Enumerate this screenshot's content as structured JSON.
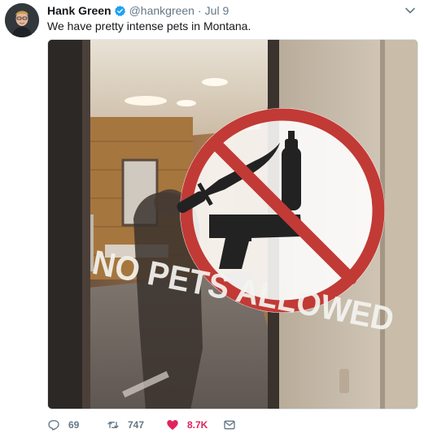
{
  "tweet": {
    "display_name": "Hank Green",
    "handle": "@hankgreen",
    "separator": "·",
    "time": "Jul 9",
    "text": "We have pretty intense pets in Montana."
  },
  "media": {
    "sign_text": "NO PETS ALLOWED"
  },
  "actions": {
    "reply_count": "69",
    "retweet_count": "747",
    "like_count": "8.7K"
  },
  "colors": {
    "like": "#e0245e",
    "verified": "#1da1f2",
    "muted": "#657786",
    "sign_red": "#c23a35"
  },
  "icons": {
    "avatar": "avatar",
    "verified": "verified-badge-icon",
    "more": "chevron-down-icon",
    "reply": "reply-icon",
    "retweet": "retweet-icon",
    "like": "heart-icon",
    "dm": "envelope-icon"
  }
}
